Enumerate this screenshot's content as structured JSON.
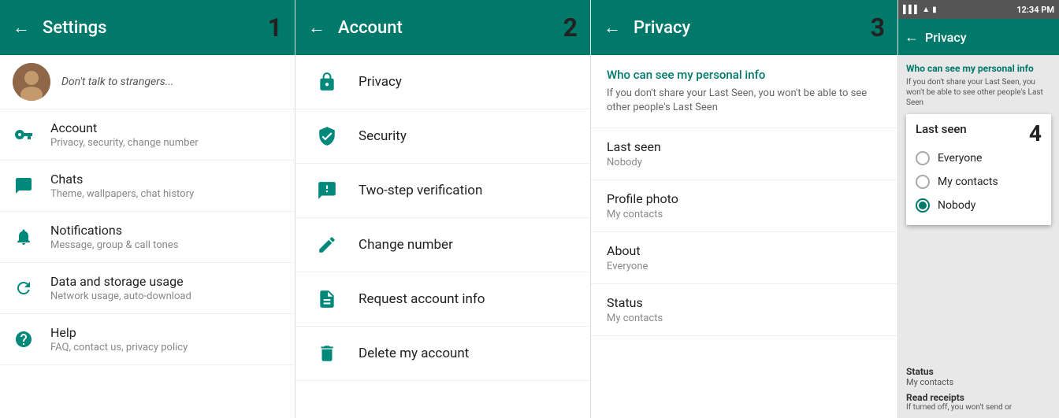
{
  "panel1": {
    "title": "Settings",
    "number": "1",
    "profile_name": "Don't talk to strangers...",
    "items": [
      {
        "label": "Account",
        "sublabel": "Privacy, security, change number",
        "icon": "key"
      },
      {
        "label": "Chats",
        "sublabel": "Theme, wallpapers, chat history",
        "icon": "chat"
      },
      {
        "label": "Notifications",
        "sublabel": "Message, group & call tones",
        "icon": "bell"
      },
      {
        "label": "Data and storage usage",
        "sublabel": "Network usage, auto-download",
        "icon": "refresh"
      },
      {
        "label": "Help",
        "sublabel": "FAQ, contact us, privacy policy",
        "icon": "help"
      }
    ]
  },
  "panel2": {
    "title": "Account",
    "number": "2",
    "items": [
      {
        "label": "Privacy",
        "icon": "lock"
      },
      {
        "label": "Security",
        "icon": "shield"
      },
      {
        "label": "Two-step verification",
        "icon": "dots"
      },
      {
        "label": "Change number",
        "icon": "phone-edit"
      },
      {
        "label": "Request account info",
        "icon": "doc"
      },
      {
        "label": "Delete my account",
        "icon": "trash"
      }
    ]
  },
  "panel3": {
    "title": "Privacy",
    "number": "3",
    "info_title": "Who can see my personal info",
    "info_desc": "If you don't share your Last Seen, you won't be able to see other people's Last Seen",
    "items": [
      {
        "label": "Last seen",
        "value": "Nobody"
      },
      {
        "label": "Profile photo",
        "value": "My contacts"
      },
      {
        "label": "About",
        "value": "Everyone"
      },
      {
        "label": "Status",
        "value": "My contacts"
      }
    ]
  },
  "panel4": {
    "number": "4",
    "phone_time": "12:34 PM",
    "privacy_title": "Privacy",
    "who_title": "Who can see my personal info",
    "who_desc": "If you don't share your Last Seen, you won't be able to see other people's Last Seen",
    "dialog_title": "Last seen",
    "options": [
      {
        "label": "Everyone",
        "selected": false
      },
      {
        "label": "My contacts",
        "selected": false
      },
      {
        "label": "Nobody",
        "selected": true
      }
    ],
    "status_label": "Status",
    "status_value": "My contacts",
    "read_label": "Read receipts",
    "read_desc": "If turned off, you won't send or"
  }
}
